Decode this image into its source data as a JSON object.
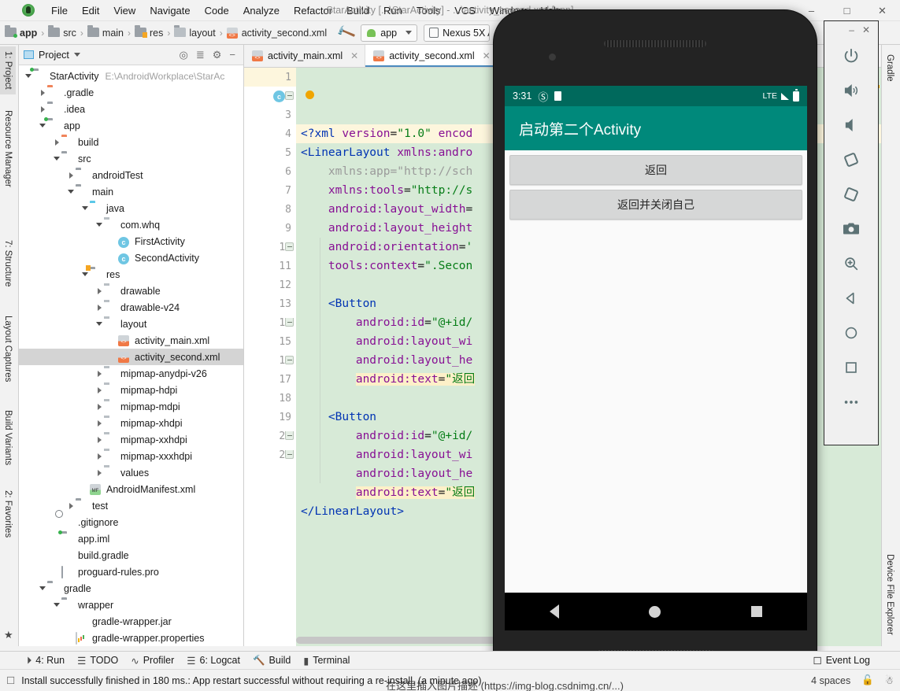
{
  "window": {
    "title": "StarActivity [...\\StarActivity] - ...\\activity_second.xml [app]",
    "minimize": "–",
    "maximize": "□",
    "close": "✕"
  },
  "menu": [
    "File",
    "Edit",
    "View",
    "Navigate",
    "Code",
    "Analyze",
    "Refactor",
    "Build",
    "Run",
    "Tools",
    "VCS",
    "Window",
    "Help"
  ],
  "toolbar": {
    "breadcrumb": [
      "app",
      "src",
      "main",
      "res",
      "layout",
      "activity_second.xml"
    ],
    "run_config": "app",
    "device": "Nexus 5X A",
    "build_icon": "hammer-icon"
  },
  "left_strip": [
    "1: Project",
    "Resource Manager",
    "7: Structure",
    "Layout Captures",
    "Build Variants",
    "2: Favorites"
  ],
  "right_strip": [
    "Gradle",
    "Device File Explorer"
  ],
  "project_panel": {
    "title": "Project",
    "icons": [
      "locate-icon",
      "collapse-all-icon",
      "gear-icon",
      "hide-icon"
    ],
    "tree": [
      {
        "depth": 0,
        "arrow": "down",
        "icon": "module",
        "label": "StarActivity",
        "path": "E:\\AndroidWorkplace\\StarAc"
      },
      {
        "depth": 1,
        "arrow": "right",
        "icon": "orange",
        "label": ".gradle",
        "path": ""
      },
      {
        "depth": 1,
        "arrow": "right",
        "icon": "grey",
        "label": ".idea",
        "path": ""
      },
      {
        "depth": 1,
        "arrow": "down",
        "icon": "module",
        "label": "app",
        "path": ""
      },
      {
        "depth": 2,
        "arrow": "right",
        "icon": "orange",
        "label": "build",
        "path": ""
      },
      {
        "depth": 2,
        "arrow": "down",
        "icon": "grey",
        "label": "src",
        "path": ""
      },
      {
        "depth": 3,
        "arrow": "right",
        "icon": "grey",
        "label": "androidTest",
        "path": ""
      },
      {
        "depth": 3,
        "arrow": "down",
        "icon": "grey",
        "label": "main",
        "path": ""
      },
      {
        "depth": 4,
        "arrow": "down",
        "icon": "blue",
        "label": "java",
        "path": ""
      },
      {
        "depth": 5,
        "arrow": "down",
        "icon": "pkg",
        "label": "com.whq",
        "path": ""
      },
      {
        "depth": 6,
        "arrow": "none",
        "icon": "class",
        "label": "FirstActivity",
        "path": ""
      },
      {
        "depth": 6,
        "arrow": "none",
        "icon": "class",
        "label": "SecondActivity",
        "path": ""
      },
      {
        "depth": 4,
        "arrow": "down",
        "icon": "res",
        "label": "res",
        "path": ""
      },
      {
        "depth": 5,
        "arrow": "right",
        "icon": "pkg",
        "label": "drawable",
        "path": ""
      },
      {
        "depth": 5,
        "arrow": "right",
        "icon": "pkg",
        "label": "drawable-v24",
        "path": ""
      },
      {
        "depth": 5,
        "arrow": "down",
        "icon": "pkg",
        "label": "layout",
        "path": ""
      },
      {
        "depth": 6,
        "arrow": "none",
        "icon": "xml",
        "label": "activity_main.xml",
        "path": ""
      },
      {
        "depth": 6,
        "arrow": "none",
        "icon": "xml",
        "label": "activity_second.xml",
        "path": "",
        "selected": true
      },
      {
        "depth": 5,
        "arrow": "right",
        "icon": "pkg",
        "label": "mipmap-anydpi-v26",
        "path": ""
      },
      {
        "depth": 5,
        "arrow": "right",
        "icon": "pkg",
        "label": "mipmap-hdpi",
        "path": ""
      },
      {
        "depth": 5,
        "arrow": "right",
        "icon": "pkg",
        "label": "mipmap-mdpi",
        "path": ""
      },
      {
        "depth": 5,
        "arrow": "right",
        "icon": "pkg",
        "label": "mipmap-xhdpi",
        "path": ""
      },
      {
        "depth": 5,
        "arrow": "right",
        "icon": "pkg",
        "label": "mipmap-xxhdpi",
        "path": ""
      },
      {
        "depth": 5,
        "arrow": "right",
        "icon": "pkg",
        "label": "mipmap-xxxhdpi",
        "path": ""
      },
      {
        "depth": 5,
        "arrow": "right",
        "icon": "pkg",
        "label": "values",
        "path": ""
      },
      {
        "depth": 4,
        "arrow": "none",
        "icon": "manifest",
        "label": "AndroidManifest.xml",
        "path": ""
      },
      {
        "depth": 3,
        "arrow": "right",
        "icon": "grey",
        "label": "test",
        "path": ""
      },
      {
        "depth": 2,
        "arrow": "none",
        "icon": "gitignore",
        "label": ".gitignore",
        "path": ""
      },
      {
        "depth": 2,
        "arrow": "none",
        "icon": "module",
        "label": "app.iml",
        "path": ""
      },
      {
        "depth": 2,
        "arrow": "none",
        "icon": "gradlefile",
        "label": "build.gradle",
        "path": ""
      },
      {
        "depth": 2,
        "arrow": "none",
        "icon": "pro",
        "label": "proguard-rules.pro",
        "path": ""
      },
      {
        "depth": 1,
        "arrow": "down",
        "icon": "grey",
        "label": "gradle",
        "path": ""
      },
      {
        "depth": 2,
        "arrow": "down",
        "icon": "grey",
        "label": "wrapper",
        "path": ""
      },
      {
        "depth": 3,
        "arrow": "none",
        "icon": "jar",
        "label": "gradle-wrapper.jar",
        "path": ""
      },
      {
        "depth": 3,
        "arrow": "none",
        "icon": "prop",
        "label": "gradle-wrapper.properties",
        "path": ""
      }
    ]
  },
  "editor": {
    "tabs": [
      {
        "label": "activity_main.xml",
        "active": false
      },
      {
        "label": "activity_second.xml",
        "active": true
      }
    ],
    "lines": [
      {
        "n": 1,
        "current": true,
        "html": "<span class=\"tk-tag\">&lt;?xml </span><span class=\"tk-attr\">version</span><span class=\"tk-eq\">=</span><span class=\"tk-str\">\"1.0\"</span><span class=\"tk-attr\"> encod</span>"
      },
      {
        "n": 2,
        "current": false,
        "fold": "start",
        "marker": "class",
        "html": "<span class=\"tk-tag\">&lt;LinearLayout </span><span class=\"tk-attr\">xmlns:andro</span>"
      },
      {
        "n": 3,
        "current": false,
        "html": "    <span class=\"tk-grey\">xmlns:app=\"http://sch</span>"
      },
      {
        "n": 4,
        "current": false,
        "html": "    <span class=\"tk-attr\">xmlns:tools</span><span class=\"tk-eq\">=</span><span class=\"tk-str\">\"http://s</span>"
      },
      {
        "n": 5,
        "current": false,
        "html": "    <span class=\"tk-attr\">android:layout_width</span><span class=\"tk-eq\">=</span>"
      },
      {
        "n": 6,
        "current": false,
        "html": "    <span class=\"tk-attr\">android:layout_height</span>"
      },
      {
        "n": 7,
        "current": false,
        "html": "    <span class=\"tk-attr\">android:orientation</span><span class=\"tk-eq\">=</span><span class=\"tk-str\">'</span>"
      },
      {
        "n": 8,
        "current": false,
        "html": "    <span class=\"tk-attr\">tools:context</span><span class=\"tk-eq\">=</span><span class=\"tk-str\">\".Secon</span>"
      },
      {
        "n": 9,
        "current": false,
        "html": ""
      },
      {
        "n": 10,
        "current": false,
        "fold": "start",
        "html": "    <span class=\"tk-tag\">&lt;Button</span>"
      },
      {
        "n": 11,
        "current": false,
        "html": "        <span class=\"tk-attr\">android:id</span><span class=\"tk-eq\">=</span><span class=\"tk-str\">\"@+id/</span>"
      },
      {
        "n": 12,
        "current": false,
        "html": "        <span class=\"tk-attr\">android:layout_wi</span>"
      },
      {
        "n": 13,
        "current": false,
        "html": "        <span class=\"tk-attr\">android:layout_he</span>"
      },
      {
        "n": 14,
        "current": false,
        "fold": "end",
        "html": "        <span class=\"hl\"><span class=\"tk-attr\">android:text</span><span class=\"tk-eq\">=</span><span class=\"tk-str\">\"返回</span></span>"
      },
      {
        "n": 15,
        "current": false,
        "html": ""
      },
      {
        "n": 16,
        "current": false,
        "fold": "start",
        "html": "    <span class=\"tk-tag\">&lt;Button</span>"
      },
      {
        "n": 17,
        "current": false,
        "html": "        <span class=\"tk-attr\">android:id</span><span class=\"tk-eq\">=</span><span class=\"tk-str\">\"@+id/</span>"
      },
      {
        "n": 18,
        "current": false,
        "html": "        <span class=\"tk-attr\">android:layout_wi</span>"
      },
      {
        "n": 19,
        "current": false,
        "html": "        <span class=\"tk-attr\">android:layout_he</span>"
      },
      {
        "n": 20,
        "current": false,
        "fold": "end",
        "html": "        <span class=\"hl\"><span class=\"tk-attr\">android:text</span><span class=\"tk-eq\">=</span><span class=\"tk-str\">\"返回</span></span>"
      },
      {
        "n": 21,
        "current": false,
        "fold": "end",
        "html": "<span class=\"tk-tag\">&lt;/LinearLayout&gt;</span>"
      }
    ]
  },
  "emulator": {
    "window_controls": {
      "minimize": "–",
      "close": "✕"
    },
    "tools": [
      "power-icon",
      "volume-up-icon",
      "volume-down-icon",
      "rotate-left-icon",
      "rotate-right-icon",
      "camera-icon",
      "zoom-icon",
      "back-icon",
      "home-icon",
      "overview-icon",
      "more-icon"
    ],
    "device": {
      "status_time": "3:31",
      "status_icons": [
        "dnd-icon",
        "screenshot-icon"
      ],
      "network": "LTE",
      "signal_icon": "signal-off-icon",
      "battery_icon": "battery-full-icon",
      "app_title": "启动第二个Activity",
      "buttons": [
        "返回",
        "返回并关闭自己"
      ],
      "nav": [
        "back-icon",
        "home-icon",
        "recents-icon"
      ]
    }
  },
  "bottom": {
    "tool_windows": [
      {
        "icon": "run-icon",
        "label": "4: Run"
      },
      {
        "icon": "todo-icon",
        "label": "TODO"
      },
      {
        "icon": "profiler-icon",
        "label": "Profiler"
      },
      {
        "icon": "logcat-icon",
        "label": "6: Logcat"
      },
      {
        "icon": "build-icon",
        "label": "Build"
      },
      {
        "icon": "terminal-icon",
        "label": "Terminal"
      }
    ],
    "event_log": "Event Log",
    "status_message": "Install successfully finished in 180 ms.: App restart successful without requiring a re-install. (a minute ago)",
    "indent": "4 spaces",
    "right_icons": [
      "lock-icon",
      "inspector-icon"
    ],
    "behind_text": "在这里插入图片描述 (https://img-blog.csdnimg.cn/...)"
  },
  "colors": {
    "accent_teal": "#00897b",
    "status_teal": "#00695c",
    "editor_bg": "#d7ead7",
    "highlight": "#fdf0c8",
    "chrome": "#f2f2f2"
  }
}
